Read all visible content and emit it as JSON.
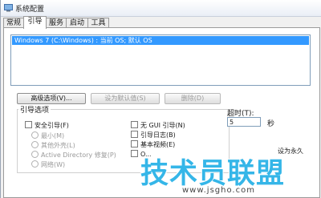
{
  "window": {
    "title": "系统配置"
  },
  "tabs": [
    {
      "label": "常规",
      "active": false
    },
    {
      "label": "引导",
      "active": true
    },
    {
      "label": "服务",
      "active": false
    },
    {
      "label": "启动",
      "active": false
    },
    {
      "label": "工具",
      "active": false
    }
  ],
  "os_list": {
    "items": [
      "Windows 7 (C:\\Windows) : 当前 OS; 默认 OS"
    ],
    "selected_index": 0
  },
  "buttons": {
    "advanced": "高级选项(V)...",
    "set_default": "设为默认值(S)",
    "delete": "删除(D)"
  },
  "boot_options": {
    "group_label": "引导选项",
    "safe_boot": "安全引导(F)",
    "minimal": "最小(M)",
    "alternate_shell": "其他外壳(L)",
    "active_directory": "Active Directory 修复(P)",
    "network": "网络(W)",
    "no_gui": "无 GUI 引导(N)",
    "boot_log": "引导日志(B)",
    "base_video": "基本视频(E)",
    "os_boot_info": "O..."
  },
  "timeout": {
    "label": "超时(T):",
    "value": "5",
    "unit": "秒",
    "tail": "设为永久"
  },
  "watermark": {
    "text": "技术员联盟",
    "url": "www.jsgho.com"
  },
  "colors": {
    "selection": "#3399ff",
    "watermark": "#35b6e8"
  }
}
